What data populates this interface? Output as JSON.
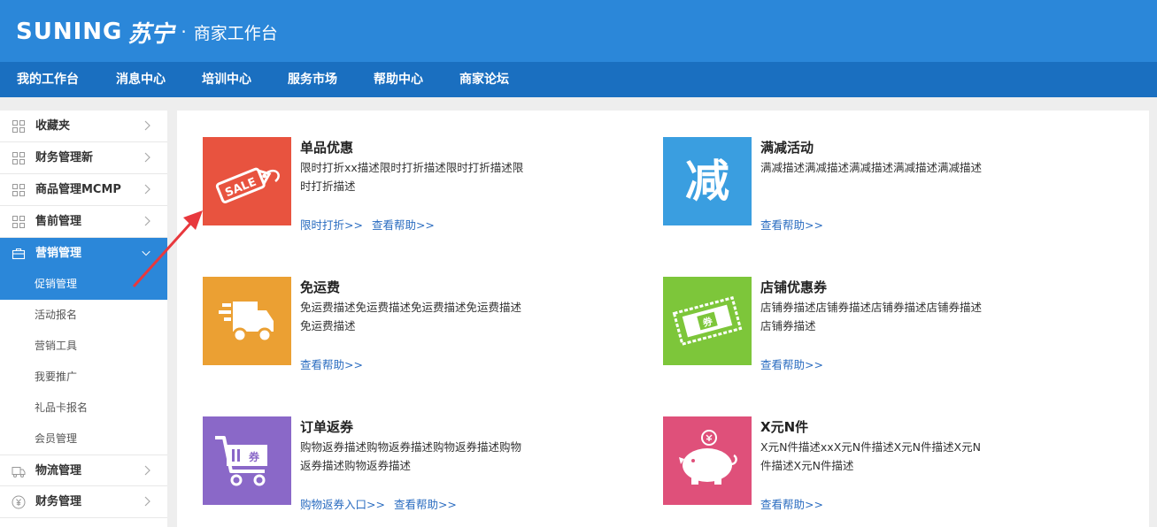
{
  "header": {
    "brand_en": "SUNING",
    "brand_cn": "苏宁",
    "dot": "·",
    "subtitle": "商家工作台"
  },
  "nav": {
    "items": [
      "我的工作台",
      "消息中心",
      "培训中心",
      "服务市场",
      "帮助中心",
      "商家论坛"
    ]
  },
  "sidebar": {
    "favorites": "收藏夹",
    "finance_new": "财务管理新",
    "goods_mcmp": "商品管理MCMP",
    "presale": "售前管理",
    "marketing": "营销管理",
    "marketing_sub": [
      "促销管理",
      "活动报名",
      "营销工具",
      "我要推广",
      "礼品卡报名",
      "会员管理"
    ],
    "logistics": "物流管理",
    "finance": "财务管理"
  },
  "cards": [
    {
      "icon": "sale-tag-icon",
      "color": "#e8533f",
      "title": "单品优惠",
      "desc": "限时打折xx描述限时打折描述限时打折描述限时打折描述",
      "links": [
        "限时打折>>",
        "查看帮助>>"
      ]
    },
    {
      "icon": "reduce-char-icon",
      "color": "#3a9ee0",
      "glyph": "减",
      "title": "满减活动",
      "desc": "满减描述满减描述满减描述满减描述满减描述",
      "links": [
        "查看帮助>>"
      ]
    },
    {
      "icon": "delivery-truck-icon",
      "color": "#eba033",
      "title": "免运费",
      "desc": "免运费描述免运费描述免运费描述免运费描述免运费描述",
      "links": [
        "查看帮助>>"
      ]
    },
    {
      "icon": "coupon-ticket-icon",
      "color": "#7dc63a",
      "ticket_text": "券",
      "title": "店铺优惠券",
      "desc": "店铺券描述店铺券描述店铺券描述店铺券描述店铺券描述",
      "links": [
        "查看帮助>>"
      ]
    },
    {
      "icon": "cart-coupon-icon",
      "color": "#8a68c8",
      "cart_text": "券",
      "title": "订单返券",
      "desc": "购物返券描述购物返券描述购物返券描述购物返券描述购物返券描述",
      "links": [
        "购物返券入口>>",
        "查看帮助>>"
      ]
    },
    {
      "icon": "piggy-bank-icon",
      "color": "#df507a",
      "title": "X元N件",
      "desc": "X元N件描述xxX元N件描述X元N件描述X元N件描述X元N件描述",
      "links": [
        "查看帮助>>"
      ]
    }
  ],
  "colors": {
    "header_bg": "#2b87d9",
    "nav_bg": "#1a6fc0",
    "link": "#2a6cc0",
    "annotation_arrow": "#e8383d"
  }
}
